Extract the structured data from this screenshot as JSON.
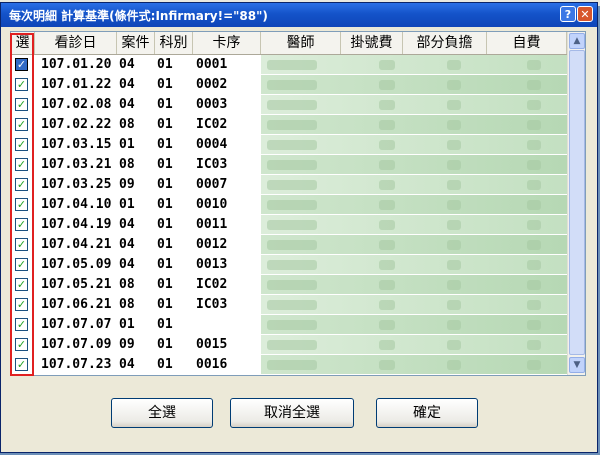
{
  "window": {
    "title": "每次明細 計算基準(條件式:Infirmary!=\"88\")"
  },
  "columns": [
    "選",
    "看診日",
    "案件",
    "科別",
    "卡序",
    "醫師",
    "掛號費",
    "部分負擔",
    "自費"
  ],
  "rows": [
    {
      "date": "107.01.20",
      "case": "04",
      "dept": "01",
      "card": "0001"
    },
    {
      "date": "107.01.22",
      "case": "04",
      "dept": "01",
      "card": "0002"
    },
    {
      "date": "107.02.08",
      "case": "04",
      "dept": "01",
      "card": "0003"
    },
    {
      "date": "107.02.22",
      "case": "08",
      "dept": "01",
      "card": "IC02"
    },
    {
      "date": "107.03.15",
      "case": "01",
      "dept": "01",
      "card": "0004"
    },
    {
      "date": "107.03.21",
      "case": "08",
      "dept": "01",
      "card": "IC03"
    },
    {
      "date": "107.03.25",
      "case": "09",
      "dept": "01",
      "card": "0007"
    },
    {
      "date": "107.04.10",
      "case": "01",
      "dept": "01",
      "card": "0010"
    },
    {
      "date": "107.04.19",
      "case": "04",
      "dept": "01",
      "card": "0011"
    },
    {
      "date": "107.04.21",
      "case": "04",
      "dept": "01",
      "card": "0012"
    },
    {
      "date": "107.05.09",
      "case": "04",
      "dept": "01",
      "card": "0013"
    },
    {
      "date": "107.05.21",
      "case": "08",
      "dept": "01",
      "card": "IC02"
    },
    {
      "date": "107.06.21",
      "case": "08",
      "dept": "01",
      "card": "IC03"
    },
    {
      "date": "107.07.07",
      "case": "01",
      "dept": "01",
      "card": ""
    },
    {
      "date": "107.07.09",
      "case": "09",
      "dept": "01",
      "card": "0015"
    },
    {
      "date": "107.07.23",
      "case": "04",
      "dept": "01",
      "card": "0016"
    }
  ],
  "buttons": {
    "select_all": "全選",
    "deselect_all": "取消全選",
    "confirm": "確定"
  },
  "icons": {
    "help": "help-icon",
    "close": "close-icon",
    "check": "check-icon"
  },
  "colors": {
    "highlight": "#e02020",
    "row_green": "#b6d8b4"
  }
}
